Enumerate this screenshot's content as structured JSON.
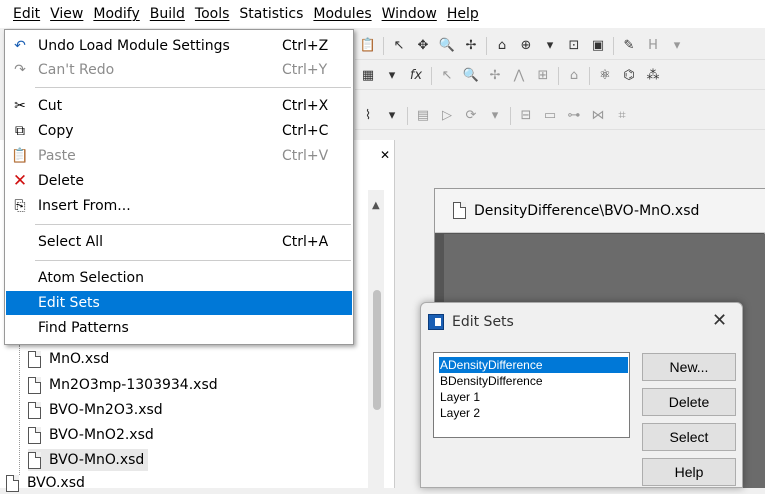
{
  "menubar": [
    "Edit",
    "View",
    "Modify",
    "Build",
    "Tools",
    "Statistics",
    "Modules",
    "Window",
    "Help"
  ],
  "edit_menu": {
    "items": [
      {
        "label": "Undo Load Module Settings",
        "shortcut": "Ctrl+Z",
        "icon": "undo-icon",
        "disabled": false
      },
      {
        "label": "Can't Redo",
        "shortcut": "Ctrl+Y",
        "icon": "redo-icon",
        "disabled": true
      },
      {
        "label": "Cut",
        "shortcut": "Ctrl+X",
        "icon": "scissors-icon",
        "disabled": false
      },
      {
        "label": "Copy",
        "shortcut": "Ctrl+C",
        "icon": "copy-icon",
        "disabled": false
      },
      {
        "label": "Paste",
        "shortcut": "Ctrl+V",
        "icon": "paste-icon",
        "disabled": true
      },
      {
        "label": "Delete",
        "shortcut": "",
        "icon": "delete-x-icon",
        "disabled": false
      },
      {
        "label": "Insert From...",
        "shortcut": "",
        "icon": "insert-icon",
        "disabled": false
      },
      {
        "label": "Select All",
        "shortcut": "Ctrl+A",
        "icon": "",
        "disabled": false
      },
      {
        "label": "Atom Selection",
        "shortcut": "",
        "icon": "",
        "disabled": false
      },
      {
        "label": "Edit Sets",
        "shortcut": "",
        "icon": "",
        "disabled": false,
        "selected": true
      },
      {
        "label": "Find Patterns",
        "shortcut": "",
        "icon": "",
        "disabled": false
      }
    ]
  },
  "tree": {
    "files": [
      "MnO.xsd",
      "Mn2O3mp-1303934.xsd",
      "BVO-Mn2O3.xsd",
      "BVO-MnO2.xsd",
      "BVO-MnO.xsd",
      "BVO.xsd"
    ],
    "selected": "BVO-MnO.xsd"
  },
  "document": {
    "title": "DensityDifference\\BVO-MnO.xsd"
  },
  "dialog": {
    "title": "Edit Sets",
    "sets": [
      "ADensityDifference",
      "BDensityDifference",
      "Layer 1",
      "Layer 2"
    ],
    "selected_set": "ADensityDifference",
    "buttons": {
      "new": "New...",
      "delete": "Delete",
      "select": "Select",
      "help": "Help"
    }
  },
  "colors": {
    "selection": "#0078d7",
    "disabled": "#8c8c8c"
  }
}
